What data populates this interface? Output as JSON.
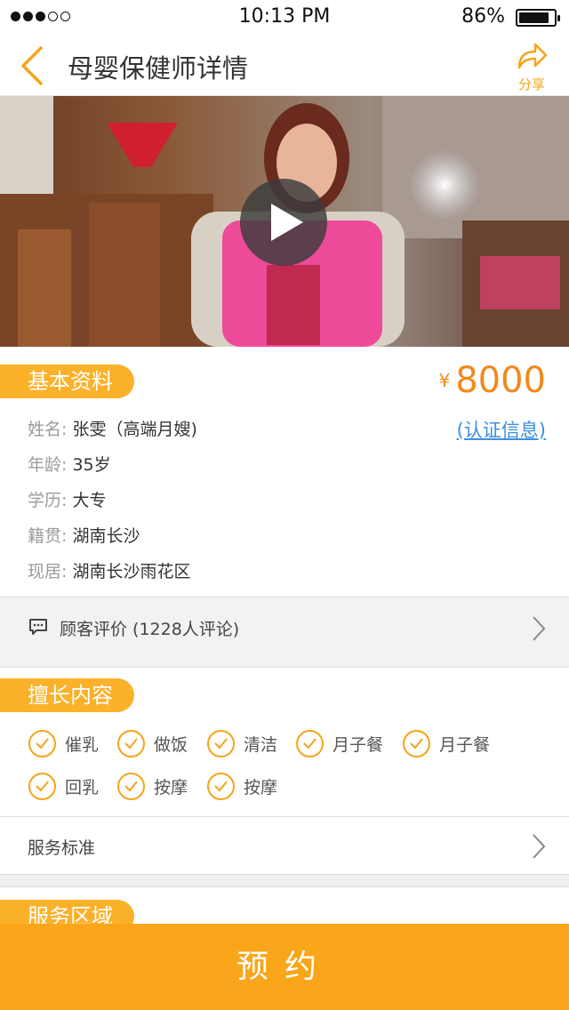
{
  "status_bar": {
    "time": "10:13 PM",
    "battery_percent": "86%",
    "battery_level": 0.86,
    "signal_bars_filled": 3,
    "signal_bars_total": 5
  },
  "nav": {
    "title": "母婴保健师详情",
    "share_label": "分享"
  },
  "basic_info": {
    "section_title": "基本资料",
    "price_currency": "¥",
    "price": "8000",
    "cert_link": "(认证信息)",
    "fields": [
      {
        "label": "姓名:",
        "value": "张雯（高端月嫂)"
      },
      {
        "label": "年龄:",
        "value": "35岁"
      },
      {
        "label": "学历:",
        "value": "大专"
      },
      {
        "label": "籍贯:",
        "value": "湖南长沙"
      },
      {
        "label": "现居:",
        "value": "湖南长沙雨花区"
      }
    ]
  },
  "reviews": {
    "label": "顾客评价 (1228人评论)"
  },
  "skills": {
    "section_title": "擅长内容",
    "items": [
      "催乳",
      "做饭",
      "清洁",
      "月子餐",
      "月子餐",
      "回乳",
      "按摩",
      "按摩"
    ]
  },
  "service_standard": {
    "label": "服务标准"
  },
  "service_area": {
    "section_title": "服务区域"
  },
  "booking": {
    "button_label": "预约"
  },
  "colors": {
    "accent": "#f9a61b",
    "tag": "#fbb12a",
    "price": "#f08a1c",
    "link": "#3d8fe0"
  }
}
